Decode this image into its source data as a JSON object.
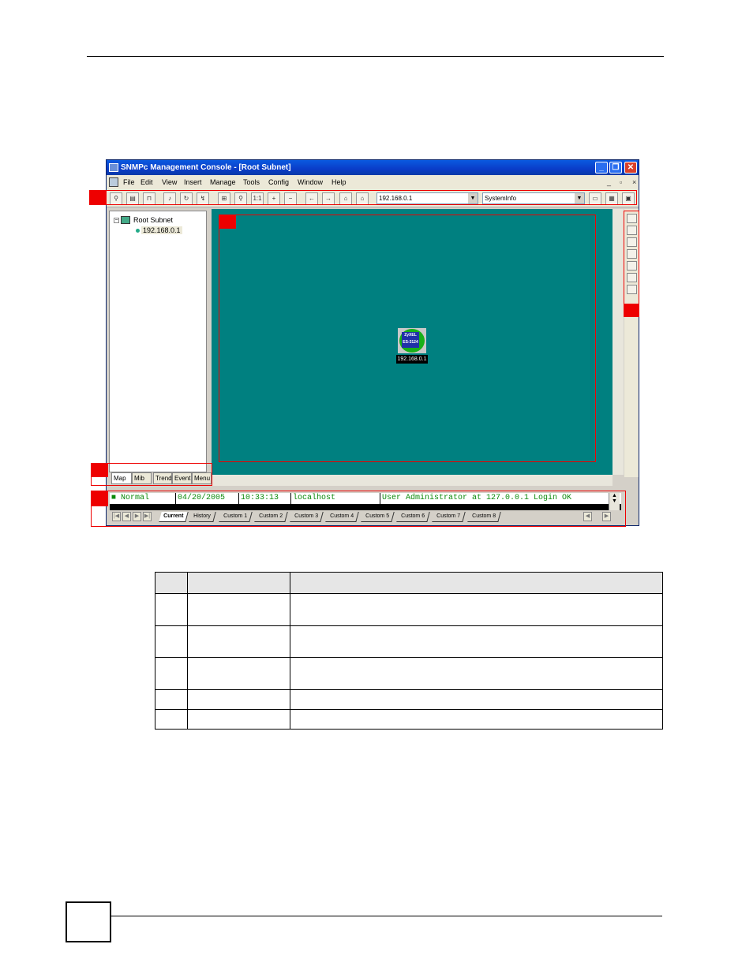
{
  "window": {
    "title": "SNMPc Management Console - [Root Subnet]",
    "minimize_label": "_",
    "maximize_label": "❐",
    "close_label": "✕"
  },
  "menu": {
    "items": [
      "File",
      "Edit",
      "View",
      "Insert",
      "Manage",
      "Tools",
      "Config",
      "Window",
      "Help"
    ],
    "mdi_min": "_",
    "mdi_restore": "▫",
    "mdi_close": "×"
  },
  "toolbar": {
    "address_value": "192.168.0.1",
    "mib_value": "SystemInfo",
    "zoom_label": "1:1"
  },
  "tree": {
    "root_label": "Root Subnet",
    "child_label": "192.168.0.1"
  },
  "pane_tabs": [
    "Map",
    "Mib",
    "Trend",
    "Event",
    "Menu"
  ],
  "map": {
    "device_brand": "ZyXEL",
    "device_model": "ES-3124",
    "device_label": "192.168.0.1"
  },
  "log": {
    "status": "Normal",
    "date": "04/20/2005",
    "time": "10:33:13",
    "host": "localhost",
    "message": "User Administrator at 127.0.0.1 Login OK"
  },
  "log_tabs": [
    "Current",
    "History",
    "Custom 1",
    "Custom 2",
    "Custom 3",
    "Custom 4",
    "Custom 5",
    "Custom 6",
    "Custom 7",
    "Custom 8"
  ],
  "colors": {
    "map_background": "#008080",
    "callout": "#e00000",
    "titlebar": "#0a46d0"
  }
}
